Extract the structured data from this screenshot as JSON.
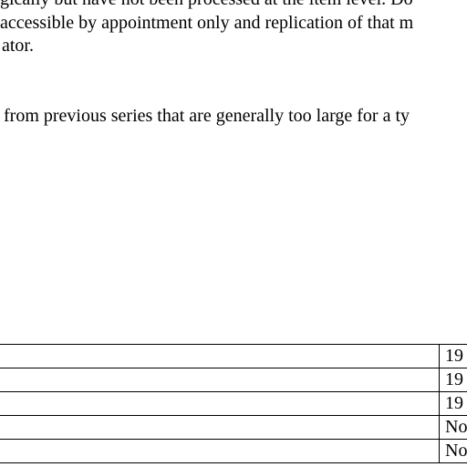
{
  "document": {
    "lines": [
      "gically but have not been processed at the item level. Do",
      "accessible by appointment only and replication of that m",
      "ator.",
      "from previous series that are generally too large for a ty"
    ]
  },
  "table": {
    "rows": [
      {
        "col_a": "",
        "col_b": "19"
      },
      {
        "col_a": "",
        "col_b": "19"
      },
      {
        "col_a": "",
        "col_b": "19"
      },
      {
        "col_a": "",
        "col_b": "No"
      },
      {
        "col_a": "",
        "col_b": "No"
      }
    ]
  }
}
